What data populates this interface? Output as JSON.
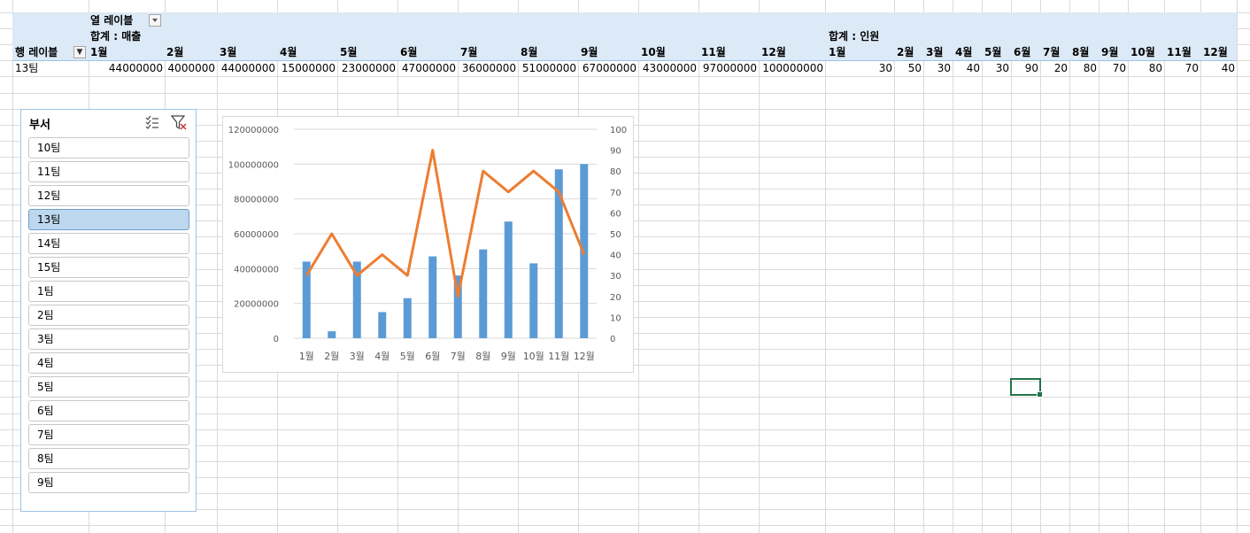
{
  "pivot": {
    "col_label_header": "열 레이블",
    "row_label_header": "행 레이블",
    "sum_sales_label": "합계 : 매출",
    "sum_staff_label": "합계 : 인원",
    "months": [
      "1월",
      "2월",
      "3월",
      "4월",
      "5월",
      "6월",
      "7월",
      "8월",
      "9월",
      "10월",
      "11월",
      "12월"
    ],
    "row_label": "13팀",
    "sales_values": [
      "44000000",
      "4000000",
      "44000000",
      "15000000",
      "23000000",
      "47000000",
      "36000000",
      "51000000",
      "67000000",
      "43000000",
      "97000000",
      "100000000"
    ],
    "staff_values": [
      "30",
      "50",
      "30",
      "40",
      "30",
      "90",
      "20",
      "80",
      "70",
      "80",
      "70",
      "40"
    ]
  },
  "slicer": {
    "title": "부서",
    "items": [
      {
        "label": "10팀",
        "selected": false
      },
      {
        "label": "11팀",
        "selected": false
      },
      {
        "label": "12팀",
        "selected": false
      },
      {
        "label": "13팀",
        "selected": true
      },
      {
        "label": "14팀",
        "selected": false
      },
      {
        "label": "15팀",
        "selected": false
      },
      {
        "label": "1팀",
        "selected": false
      },
      {
        "label": "2팀",
        "selected": false
      },
      {
        "label": "3팀",
        "selected": false
      },
      {
        "label": "4팀",
        "selected": false
      },
      {
        "label": "5팀",
        "selected": false
      },
      {
        "label": "6팀",
        "selected": false
      },
      {
        "label": "7팀",
        "selected": false
      },
      {
        "label": "8팀",
        "selected": false
      },
      {
        "label": "9팀",
        "selected": false
      }
    ],
    "icons": [
      "multi-select-icon",
      "clear-filter-icon"
    ]
  },
  "chart_data": {
    "type": "bar",
    "categories": [
      "1월",
      "2월",
      "3월",
      "4월",
      "5월",
      "6월",
      "7월",
      "8월",
      "9월",
      "10월",
      "11월",
      "12월"
    ],
    "series": [
      {
        "type": "bar",
        "axis": "left",
        "color": "#5b9bd5",
        "values": [
          44000000,
          4000000,
          44000000,
          15000000,
          23000000,
          47000000,
          36000000,
          51000000,
          67000000,
          43000000,
          97000000,
          100000000
        ]
      },
      {
        "type": "line",
        "axis": "right",
        "color": "#ed7d31",
        "values": [
          30,
          50,
          30,
          40,
          30,
          90,
          20,
          80,
          70,
          80,
          70,
          40
        ]
      }
    ],
    "ylim": [
      0,
      120000000
    ],
    "y_ticks": [
      "0",
      "20000000",
      "40000000",
      "60000000",
      "80000000",
      "100000000",
      "120000000"
    ],
    "y2lim": [
      0,
      100
    ],
    "y2_ticks": [
      "0",
      "10",
      "20",
      "30",
      "40",
      "50",
      "60",
      "70",
      "80",
      "90",
      "100"
    ],
    "grid": true,
    "legend": "none"
  },
  "colors": {
    "pivot_header_bg": "#dce9f6",
    "bar": "#5b9bd5",
    "line": "#ed7d31",
    "selected_item": "#bdd7ee",
    "active_cell": "#217346"
  }
}
